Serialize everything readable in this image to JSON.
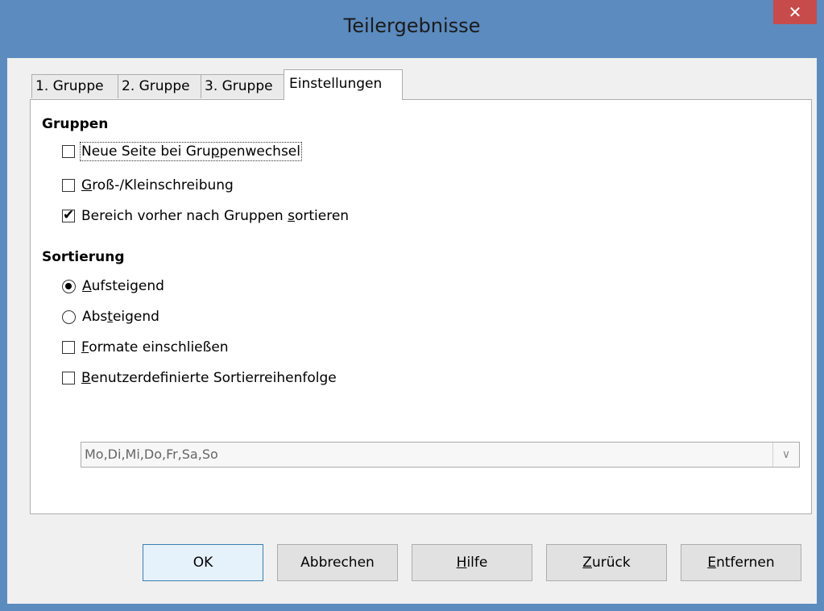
{
  "window": {
    "title": "Teilergebnisse",
    "close_glyph": "✕"
  },
  "tabs": [
    {
      "label": "1. Gruppe",
      "active": false
    },
    {
      "label": "2. Gruppe",
      "active": false
    },
    {
      "label": "3. Gruppe",
      "active": false
    },
    {
      "label": "Einstellungen",
      "active": true
    }
  ],
  "groups": {
    "heading": "Gruppen",
    "options": [
      {
        "pre": "Neue Seite bei Gru",
        "u": "p",
        "post": "penwechsel",
        "checked": false
      },
      {
        "pre": "",
        "u": "G",
        "post": "roß-/Kleinschreibung",
        "checked": false
      },
      {
        "pre": "Bereich vorher nach Gruppen ",
        "u": "s",
        "post": "ortieren",
        "checked": true
      }
    ]
  },
  "sorting": {
    "heading": "Sortierung",
    "radios": [
      {
        "pre": "",
        "u": "A",
        "post": "ufsteigend",
        "selected": true
      },
      {
        "pre": "Abs",
        "u": "t",
        "post": "eigend",
        "selected": false
      }
    ],
    "options": [
      {
        "pre": "",
        "u": "F",
        "post": "ormate einschließen",
        "checked": false
      },
      {
        "pre": "",
        "u": "B",
        "post": "enutzerdefinierte Sortierreihenfolge",
        "checked": false
      }
    ],
    "custom_order_value": "Mo,Di,Mi,Do,Fr,Sa,So",
    "combo_arrow_glyph": "∨"
  },
  "buttons": {
    "ok": {
      "pre": "",
      "u": "",
      "post": "OK"
    },
    "cancel": {
      "pre": "",
      "u": "",
      "post": "Abbrechen"
    },
    "help": {
      "pre": "",
      "u": "H",
      "post": "ilfe"
    },
    "back": {
      "pre": "",
      "u": "Z",
      "post": "urück"
    },
    "remove": {
      "pre": "",
      "u": "E",
      "post": "ntfernen"
    }
  },
  "check_glyph": "✔"
}
